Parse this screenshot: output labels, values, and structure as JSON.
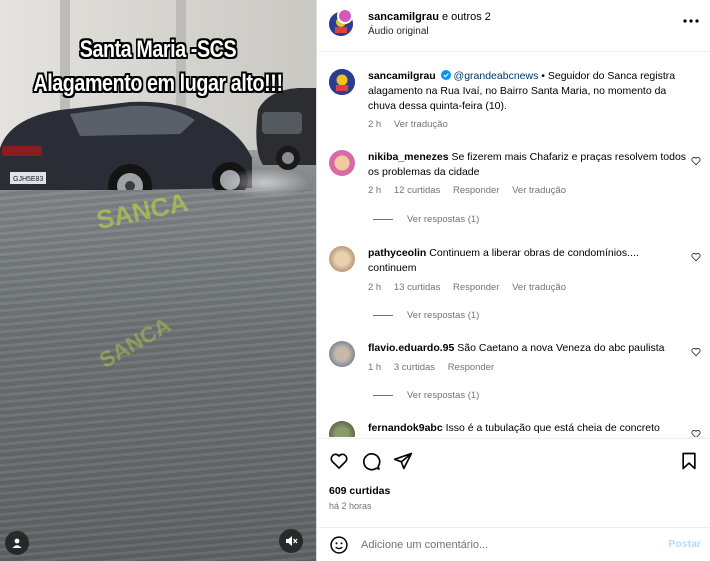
{
  "media": {
    "title_line1": "Santa Maria -SCS",
    "title_line2": "Alagamento em lugar alto!!!",
    "watermark": "SANCA",
    "plate": "GJH5E83"
  },
  "header": {
    "username": "sancamilgrau",
    "coauthors": "e outros 2",
    "audio": "Áudio original"
  },
  "caption": {
    "username": "sancamilgrau",
    "mention": "@grandeabcnews",
    "text": " • Seguidor do Sanca registra alagamento na Rua Ivaí, no Bairro Santa Maria, no momento da chuva dessa quinta-feira (10).",
    "time": "2 h",
    "translate": "Ver tradução"
  },
  "comments": [
    {
      "username": "nikiba_menezes",
      "text": "Se fizerem mais Chafariz e praças resolvem todos os problemas da cidade",
      "time": "2 h",
      "likes": "12 curtidas",
      "reply": "Responder",
      "translate": "Ver tradução",
      "view_replies": "Ver respostas (1)"
    },
    {
      "username": "pathyceolin",
      "text": "Continuem a liberar obras de condomínios.... continuem",
      "time": "2 h",
      "likes": "13 curtidas",
      "reply": "Responder",
      "translate": "Ver tradução",
      "view_replies": "Ver respostas (1)"
    },
    {
      "username": "flavio.eduardo.95",
      "text": "São Caetano a nova Veneza do abc paulista",
      "time": "1 h",
      "likes": "3 curtidas",
      "reply": "Responder",
      "view_replies": "Ver respostas (1)"
    },
    {
      "username": "fernandok9abc",
      "text": "Isso é a tubulação que está cheia de concreto"
    }
  ],
  "footer": {
    "likes": "609 curtidas",
    "time": "há 2 horas",
    "comment_placeholder": "Adicione um comentário...",
    "post_label": "Postar"
  },
  "icons": {
    "like": "heart-icon",
    "comment": "comment-icon",
    "share": "share-icon",
    "save": "bookmark-icon",
    "emoji": "emoji-icon",
    "more": "more-icon",
    "verified": "verified-icon",
    "mute": "mute-icon",
    "user_tag": "user-tag-icon"
  },
  "colors": {
    "link": "#00376b",
    "muted": "#737373",
    "post_disabled": "#b3dbff",
    "verified": "#0095f6"
  }
}
